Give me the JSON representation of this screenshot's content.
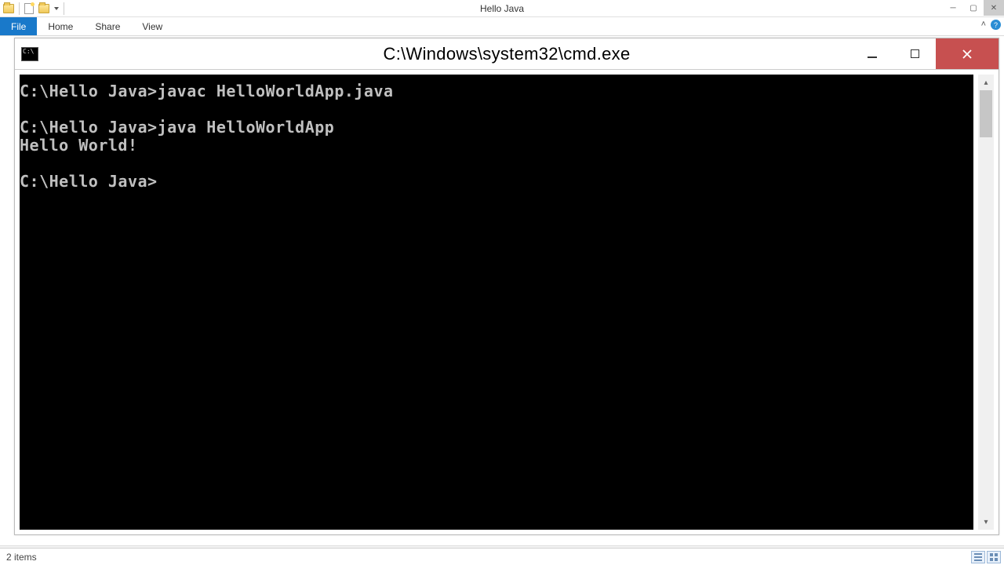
{
  "explorer": {
    "title": "Hello Java",
    "ribbon_tabs": {
      "file": "File",
      "home": "Home",
      "share": "Share",
      "view": "View"
    },
    "status": "2 items"
  },
  "cmd": {
    "title": "C:\\Windows\\system32\\cmd.exe",
    "lines": {
      "l0": "C:\\Hello Java>javac HelloWorldApp.java",
      "l1": "",
      "l2": "C:\\Hello Java>java HelloWorldApp",
      "l3": "Hello World!",
      "l4": "",
      "l5": "C:\\Hello Java>"
    }
  }
}
